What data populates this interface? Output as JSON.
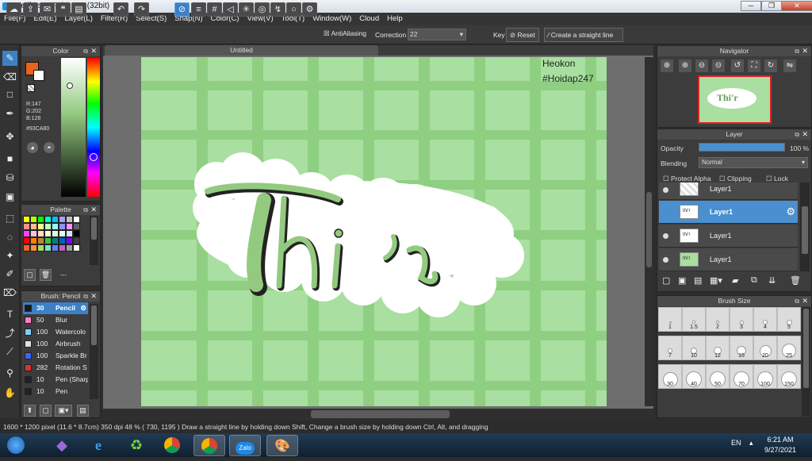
{
  "app": {
    "title": "MediBang Paint Pro (32bit)"
  },
  "menu": [
    "File(F)",
    "Edit(E)",
    "Layer(L)",
    "Filter(R)",
    "Select(S)",
    "Snap(N)",
    "Color(C)",
    "View(V)",
    "Tool(T)",
    "Window(W)",
    "Cloud",
    "Help"
  ],
  "toolbar": {
    "antialiasing_label": "AntiAliasing",
    "correction_label": "Correction",
    "correction_value": "22",
    "key_label": "Key",
    "reset_label": "Reset",
    "straight_line_label": "Create a straight line"
  },
  "color_panel": {
    "title": "Color",
    "r": "R:147",
    "g": "G:202",
    "b": "B:128",
    "hex": "#93CA80",
    "fg_color": "#e8641e",
    "bg_color": "#ffffff"
  },
  "palette_panel": {
    "title": "Palette",
    "extra": "---",
    "colors": [
      "#ffff00",
      "#c0ff00",
      "#00ff00",
      "#00ffc0",
      "#00c0ff",
      "#a0a0ff",
      "#c0c0c0",
      "#ffffff",
      "#ff9090",
      "#ffc090",
      "#ffff90",
      "#c0ffc0",
      "#90ffff",
      "#9090ff",
      "#ff90ff",
      "#606060",
      "#ff40ff",
      "#ffc0e0",
      "#ffe0c0",
      "#ffffe0",
      "#e0ffe0",
      "#e0ffff",
      "#e0e0ff",
      "#000000",
      "#ff0000",
      "#ff8000",
      "#c08040",
      "#40c040",
      "#008080",
      "#0060c0",
      "#8000ff",
      "#404040",
      "#ff6020",
      "#ff9040",
      "#a0e060",
      "#80e0c0",
      "#6080ff",
      "#c060c0",
      "#a0a0a0",
      "#ffffff"
    ]
  },
  "brush_panel": {
    "title": "Brush: Pencil",
    "items": [
      {
        "size": "30",
        "name": "Pencil",
        "color": "#1a1a1a"
      },
      {
        "size": "50",
        "name": "Blur",
        "color": "#ff80c0"
      },
      {
        "size": "100",
        "name": "Watercolo",
        "color": "#80d0ff"
      },
      {
        "size": "100",
        "name": "Airbrush",
        "color": "#e0e0e0"
      },
      {
        "size": "100",
        "name": "Sparkle Br",
        "color": "#4060ff"
      },
      {
        "size": "282",
        "name": "Rotation S",
        "color": "#e03030"
      },
      {
        "size": "10",
        "name": "Pen (Sharp",
        "color": "#222222"
      },
      {
        "size": "10",
        "name": "Pen",
        "color": "#222222"
      }
    ]
  },
  "document": {
    "tab": "Untitled",
    "watermark_line1": "Heokon",
    "watermark_line2": "#Hoidap247",
    "artwork_text": "Thi 'r"
  },
  "navigator": {
    "title": "Navigator"
  },
  "layer_panel": {
    "title": "Layer",
    "opacity_label": "Opacity",
    "opacity_value": "100 %",
    "opacity_fraction": 1.0,
    "blending_label": "Blending",
    "blending_value": "Normal",
    "protect_alpha": "Protect Alpha",
    "clipping": "Clipping",
    "lock": "Lock",
    "layers": [
      {
        "name": "Layer1"
      },
      {
        "name": "Layer1"
      },
      {
        "name": "Layer1"
      },
      {
        "name": "Layer1"
      }
    ]
  },
  "brush_size_panel": {
    "title": "Brush Size",
    "sizes": [
      "1",
      "1.5",
      "2",
      "3",
      "4",
      "5",
      "7",
      "10",
      "12",
      "15",
      "20",
      "25",
      "30",
      "40",
      "50",
      "70",
      "100",
      "150"
    ]
  },
  "status": {
    "text": "1600 * 1200 pixel   (11.6 * 8.7cm)   350 dpi   48 %   ( 730, 1195 )   Draw a straight line by holding down Shift, Change a brush size by holding down Ctrl, Alt, and dragging"
  },
  "taskbar": {
    "lang": "EN",
    "time": "6:21 AM",
    "date": "9/27/2021",
    "zalo_label": "Zalo"
  }
}
